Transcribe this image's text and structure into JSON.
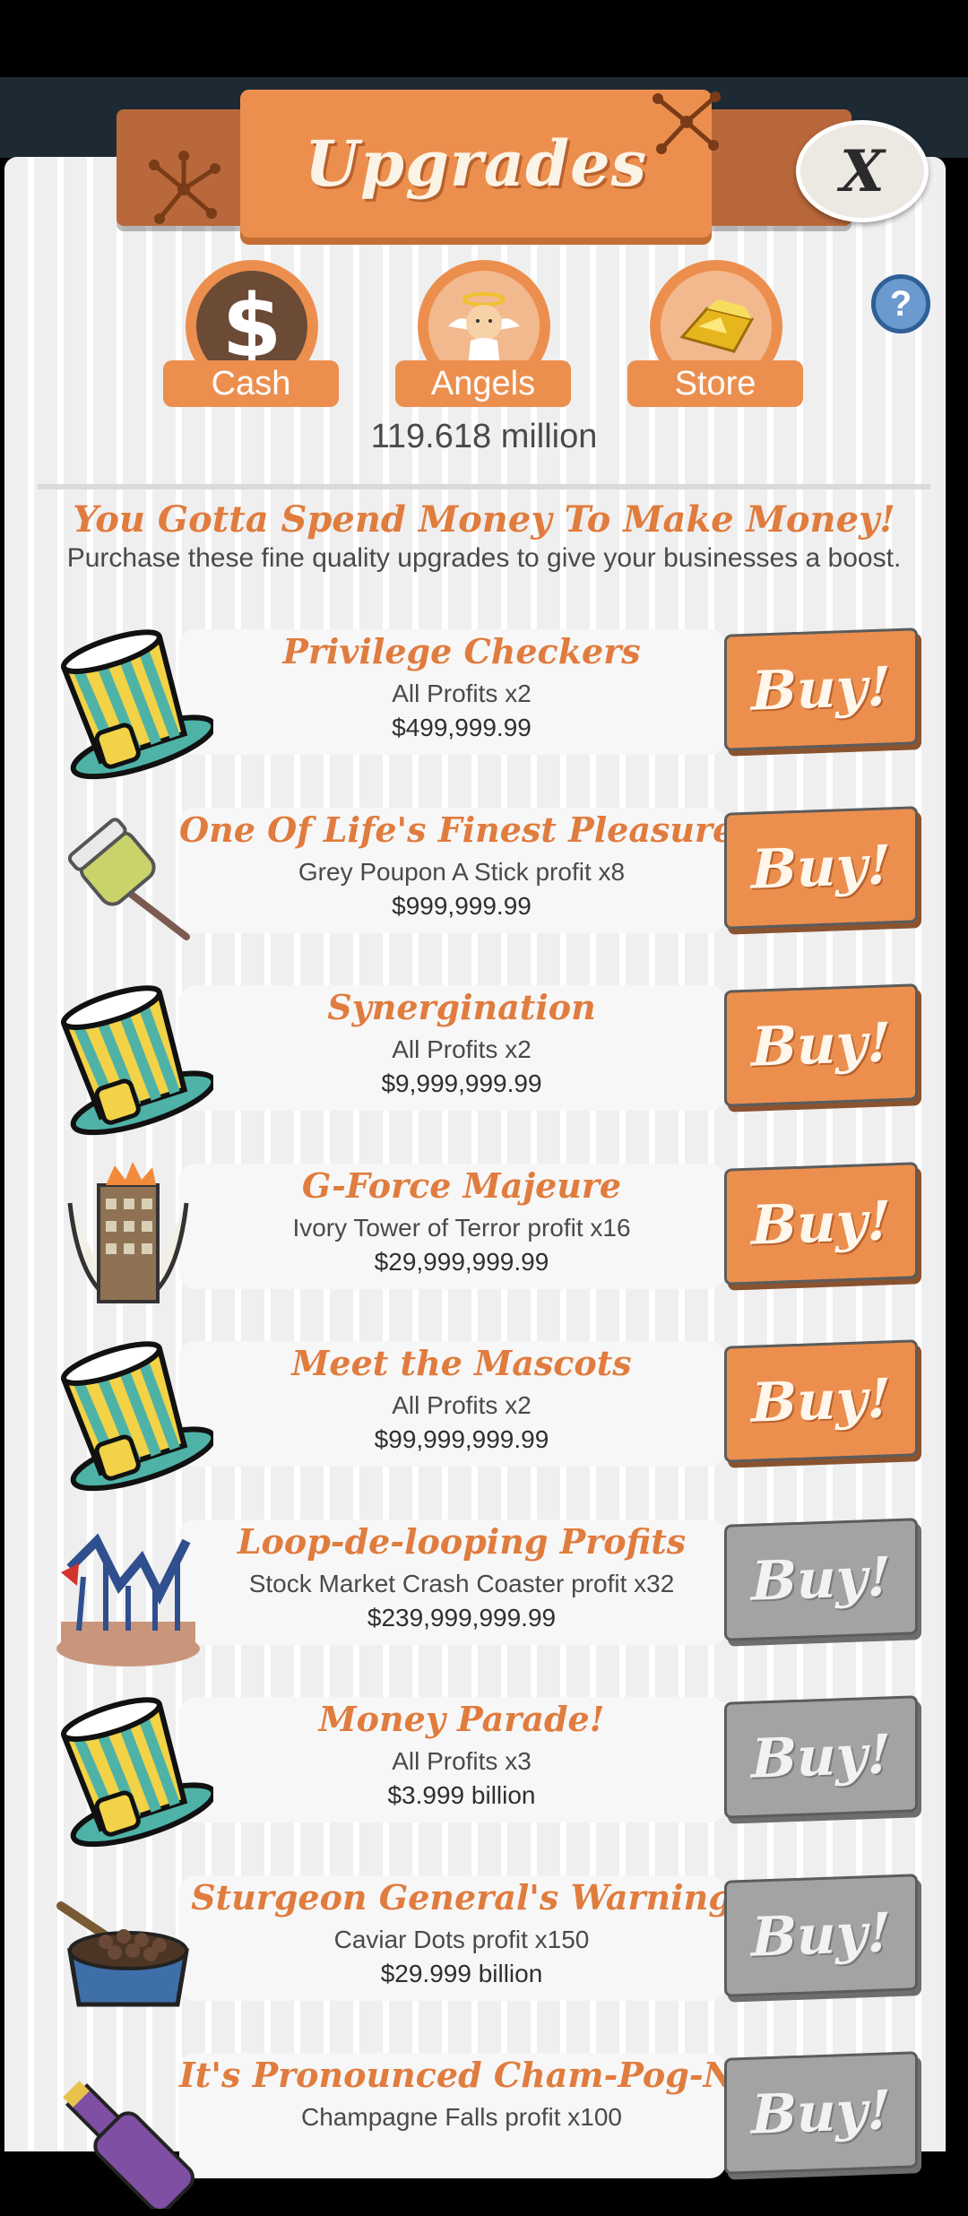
{
  "header": {
    "title": "Upgrades",
    "close_label": "X",
    "help_label": "?"
  },
  "tabs": [
    {
      "label": "Cash",
      "icon": "dollar-icon"
    },
    {
      "label": "Angels",
      "icon": "angel-icon"
    },
    {
      "label": "Store",
      "icon": "gold-bar-icon"
    }
  ],
  "balance": "119.618 million",
  "intro": {
    "headline": "You Gotta Spend Money To Make Money!",
    "subline": "Purchase these fine quality upgrades to give your businesses a boost."
  },
  "upgrades": [
    {
      "title": "Privilege Checkers",
      "desc": "All Profits x2",
      "price": "$499,999.99",
      "buy": "Buy!",
      "affordable": true,
      "icon": "top-hat-icon"
    },
    {
      "title": "One Of Life's Finest Pleasures",
      "desc": "Grey Poupon A Stick profit x8",
      "price": "$999,999.99",
      "buy": "Buy!",
      "affordable": true,
      "icon": "mustard-jar-icon"
    },
    {
      "title": "Synergination",
      "desc": "All Profits x2",
      "price": "$9,999,999.99",
      "buy": "Buy!",
      "affordable": true,
      "icon": "top-hat-icon"
    },
    {
      "title": "G-Force Majeure",
      "desc": "Ivory Tower of Terror profit x16",
      "price": "$29,999,999.99",
      "buy": "Buy!",
      "affordable": true,
      "icon": "ivory-tower-icon"
    },
    {
      "title": "Meet the Mascots",
      "desc": "All Profits x2",
      "price": "$99,999,999.99",
      "buy": "Buy!",
      "affordable": true,
      "icon": "top-hat-icon"
    },
    {
      "title": "Loop-de-looping Profits",
      "desc": "Stock Market Crash Coaster profit x32",
      "price": "$239,999,999.99",
      "buy": "Buy!",
      "affordable": false,
      "icon": "roller-coaster-icon"
    },
    {
      "title": "Money Parade!",
      "desc": "All Profits x3",
      "price": "$3.999 billion",
      "buy": "Buy!",
      "affordable": false,
      "icon": "top-hat-icon"
    },
    {
      "title": "Sturgeon General's Warning",
      "desc": "Caviar Dots profit x150",
      "price": "$29.999 billion",
      "buy": "Buy!",
      "affordable": false,
      "icon": "caviar-bowl-icon"
    },
    {
      "title": "It's Pronounced Cham-Pog-Na",
      "desc": "Champagne Falls profit x100",
      "price": "",
      "buy": "Buy!",
      "affordable": false,
      "icon": "champagne-bottle-icon"
    }
  ],
  "colors": {
    "accent_orange": "#ec8f4e",
    "title_orange": "#e07c3e",
    "disabled_gray": "#a3a3a3",
    "help_blue": "#6a9ad0"
  }
}
